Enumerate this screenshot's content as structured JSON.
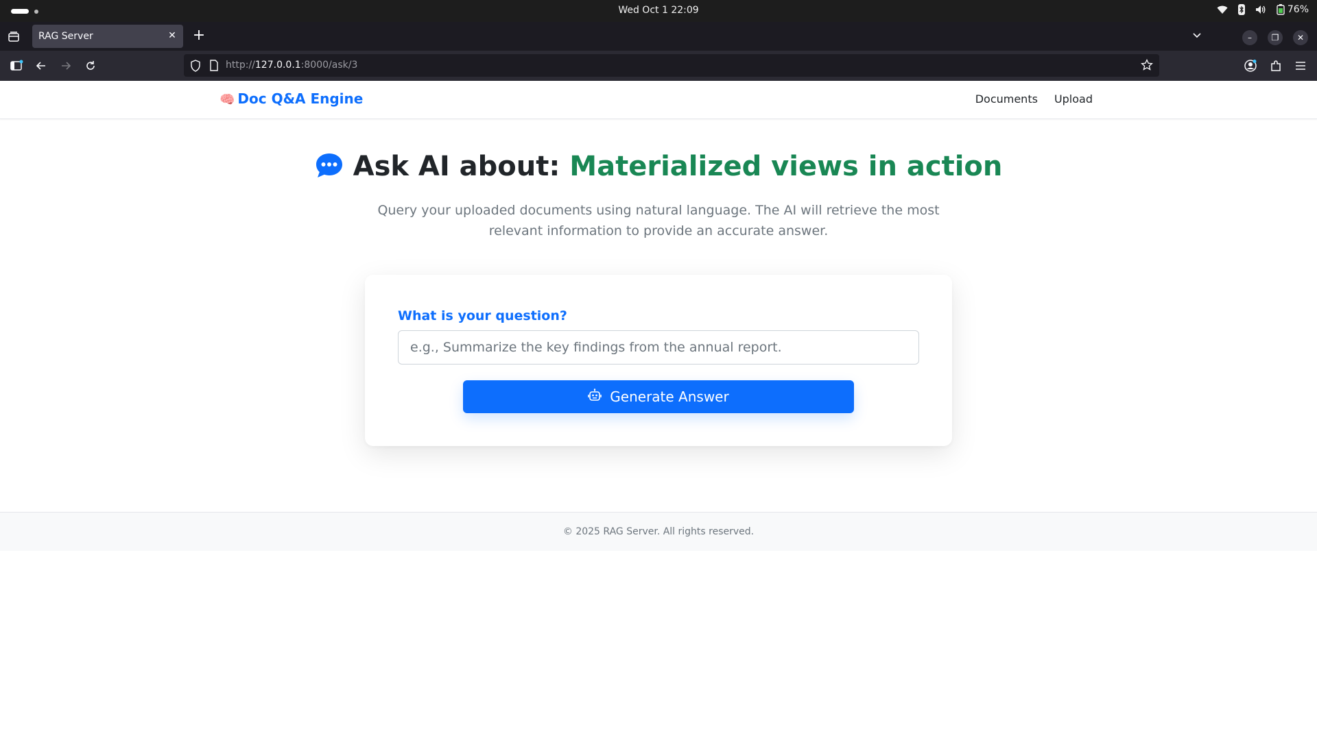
{
  "system_bar": {
    "datetime": "Wed Oct 1  22:09",
    "battery": "76%"
  },
  "browser": {
    "tab_title": "RAG Server",
    "url_prefix": "http://",
    "url_host": "127.0.0.1",
    "url_rest": ":8000/ask/3"
  },
  "site": {
    "brand_icon": "🧠",
    "brand": "Doc Q&A Engine",
    "nav_links": [
      "Documents",
      "Upload"
    ]
  },
  "hero": {
    "prefix": "Ask AI about: ",
    "topic": "Materialized views in action",
    "subtitle": "Query your uploaded documents using natural language. The AI will retrieve the most relevant information to provide an accurate answer."
  },
  "form": {
    "label": "What is your question?",
    "placeholder": "e.g., Summarize the key findings from the annual report.",
    "value": "",
    "button_label": "Generate Answer"
  },
  "footer": {
    "text": "© 2025 RAG Server. All rights reserved."
  },
  "colors": {
    "primary": "#0d6efd",
    "topic_green": "#198754",
    "muted": "#6c757d"
  }
}
